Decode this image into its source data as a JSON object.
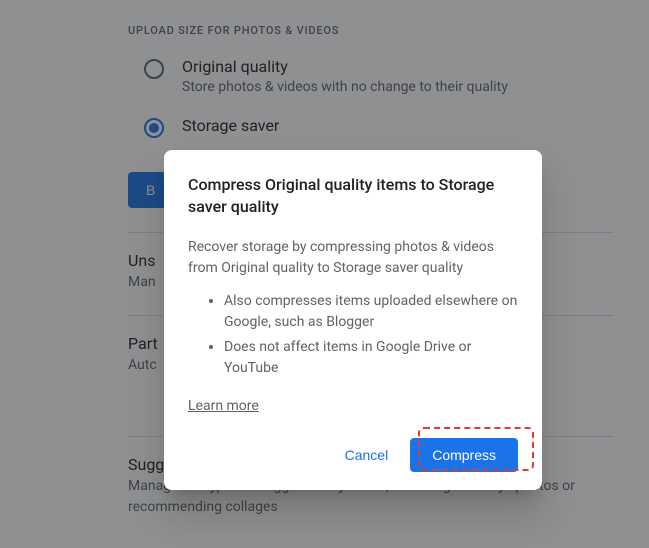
{
  "section": {
    "heading": "UPLOAD SIZE FOR PHOTOS & VIDEOS",
    "options": [
      {
        "title": "Original quality",
        "desc": "Store photos & videos with no change to their quality"
      },
      {
        "title": "Storage saver",
        "desc": ""
      }
    ],
    "button_partial": "B"
  },
  "list": [
    {
      "title": "Uns",
      "desc": "Man"
    },
    {
      "title": "Part",
      "desc": "Autc"
    },
    {
      "title": "Suggestions",
      "desc": "Manage the types of suggestions you see, like fixing sideways photos or recommending collages"
    }
  ],
  "dialog": {
    "title": "Compress Original quality items to Storage saver quality",
    "body": "Recover storage by compressing photos & videos from Original quality to Storage saver quality",
    "bullets": [
      "Also compresses items uploaded elsewhere on Google, such as Blogger",
      "Does not affect items in Google Drive or YouTube"
    ],
    "learn_more": "Learn more",
    "cancel": "Cancel",
    "confirm": "Compress"
  }
}
